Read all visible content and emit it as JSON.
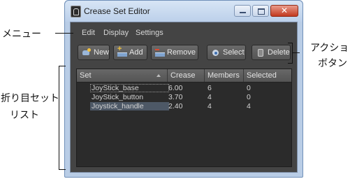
{
  "window": {
    "title": "Crease Set Editor",
    "controls": {
      "minimize": "minimize",
      "maximize": "maximize",
      "close": "✕"
    }
  },
  "menu": [
    "Edit",
    "Display",
    "Settings"
  ],
  "toolbar": [
    {
      "label": "New",
      "icon": "new-icon"
    },
    {
      "label": "Add",
      "icon": "add-icon"
    },
    {
      "label": "Remove",
      "icon": "remove-icon"
    },
    {
      "label": "Select",
      "icon": "select-icon"
    },
    {
      "label": "Delete",
      "icon": "delete-icon"
    }
  ],
  "table": {
    "columns": [
      "Set",
      "Crease",
      "Members",
      "Selected"
    ],
    "rows": [
      {
        "set": "JoyStick_base",
        "crease": "6.00",
        "members": "6",
        "selected": "0"
      },
      {
        "set": "JoyStick_button",
        "crease": "3.70",
        "members": "4",
        "selected": "0"
      },
      {
        "set": "Joystick_handle",
        "crease": "2.40",
        "members": "4",
        "selected": "4"
      }
    ]
  },
  "annotations": {
    "menu": "メニュー",
    "actions_line1": "アクショ",
    "actions_line2": "ボタン",
    "list_line1": "折り目セット",
    "list_line2": "リスト"
  },
  "colors": {
    "client_bg": "#444444",
    "table_bg": "#2b2b2b",
    "selected_row": "#4d5866",
    "titlebar": "#bcd0ea",
    "close_button": "#c2391f"
  }
}
